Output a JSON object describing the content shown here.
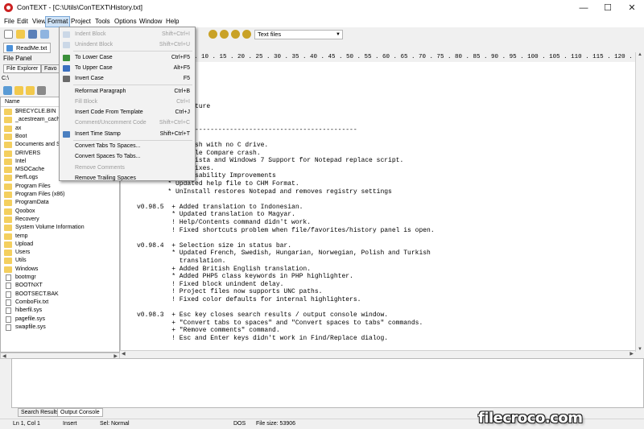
{
  "window": {
    "title": "ConTEXT - [C:\\Utils\\ConTEXT\\History.txt]",
    "minimize": "—",
    "maximize": "☐",
    "close": "✕"
  },
  "menubar": [
    "File",
    "Edit",
    "View",
    "Format",
    "Project",
    "Tools",
    "Options",
    "Window",
    "Help"
  ],
  "format_menu": {
    "items": [
      {
        "label": "Indent Block",
        "shortcut": "Shift+Ctrl+I",
        "enabled": false,
        "icon": "indent-icon"
      },
      {
        "label": "Unindent Block",
        "shortcut": "Shift+Ctrl+U",
        "enabled": false,
        "icon": "unindent-icon"
      },
      {
        "label": "To Lower Case",
        "shortcut": "Ctrl+F5",
        "enabled": true,
        "icon": "lowercase-icon"
      },
      {
        "label": "To Upper Case",
        "shortcut": "Alt+F5",
        "enabled": true,
        "icon": "uppercase-icon"
      },
      {
        "label": "Invert Case",
        "shortcut": "F5",
        "enabled": true,
        "icon": "invert-case-icon"
      },
      {
        "label": "Reformat Paragraph",
        "shortcut": "Ctrl+B",
        "enabled": true,
        "icon": ""
      },
      {
        "label": "Fill Block",
        "shortcut": "Ctrl+I",
        "enabled": false,
        "icon": ""
      },
      {
        "label": "Insert Code From Template",
        "shortcut": "Ctrl+J",
        "enabled": true,
        "icon": ""
      },
      {
        "label": "Comment/Uncomment Code",
        "shortcut": "Shift+Ctrl+C",
        "enabled": false,
        "icon": ""
      },
      {
        "label": "Insert Time Stamp",
        "shortcut": "Shift+Ctrl+T",
        "enabled": true,
        "icon": "timestamp-icon"
      },
      {
        "label": "Convert Tabs To Spaces...",
        "shortcut": "",
        "enabled": true,
        "icon": ""
      },
      {
        "label": "Convert Spaces To Tabs...",
        "shortcut": "",
        "enabled": true,
        "icon": ""
      },
      {
        "label": "Remove Comments",
        "shortcut": "",
        "enabled": false,
        "icon": ""
      },
      {
        "label": "Remove Trailing Spaces",
        "shortcut": "",
        "enabled": true,
        "icon": ""
      }
    ]
  },
  "toolbar": {
    "syntax_highlighter": "Text files"
  },
  "file_tab": "ReadMe.txt",
  "file_panel": {
    "title": "File Panel",
    "tabs": [
      "File Explorer",
      "Favo"
    ],
    "path": "C:\\",
    "column_header": "Name",
    "entries": [
      {
        "name": "$RECYCLE.BIN",
        "type": "folder"
      },
      {
        "name": "_acestream_cache",
        "type": "folder"
      },
      {
        "name": "ax",
        "type": "folder"
      },
      {
        "name": "Boot",
        "type": "folder"
      },
      {
        "name": "Documents and Se",
        "type": "folder"
      },
      {
        "name": "DRIVERS",
        "type": "folder"
      },
      {
        "name": "Intel",
        "type": "folder"
      },
      {
        "name": "MSOCache",
        "type": "folder"
      },
      {
        "name": "PerfLogs",
        "type": "folder"
      },
      {
        "name": "Program Files",
        "type": "folder"
      },
      {
        "name": "Program Files (x86)",
        "type": "folder"
      },
      {
        "name": "ProgramData",
        "type": "folder"
      },
      {
        "name": "Qoobox",
        "type": "folder"
      },
      {
        "name": "Recovery",
        "type": "folder"
      },
      {
        "name": "System Volume Information",
        "type": "folder"
      },
      {
        "name": "temp",
        "type": "folder"
      },
      {
        "name": "Upload",
        "type": "folder"
      },
      {
        "name": "Users",
        "type": "folder"
      },
      {
        "name": "Utils",
        "type": "folder"
      },
      {
        "name": "Windows",
        "type": "folder"
      },
      {
        "name": "bootmgr",
        "type": "file"
      },
      {
        "name": "BOOTNXT",
        "type": "file"
      },
      {
        "name": "BOOTSECT.BAK",
        "type": "file"
      },
      {
        "name": "ComboFix.txt",
        "type": "file"
      },
      {
        "name": "hiberfil.sys",
        "type": "file"
      },
      {
        "name": "pagefile.sys",
        "type": "file"
      },
      {
        "name": "swapfile.sys",
        "type": "file"
      }
    ]
  },
  "ruler": "2 . 10 . 15 . 20 . 25 . 30 . 35 . 40 . 45 . 50 . 55 . 60 . 65 . 70 . 75 . 80 . 85 . 90 . 95 . 100 . 105 . 110 . 115 . 120 . 125 . 130",
  "editor_lines": [
    "        NEW",
    "        ~~~",
    "",
    "",
    "          fix",
    "          d feature",
    "          ged",
    "",
    "    -----------------------------------------------------",
    "",
    "          s crash with no C drive.",
    "          ed File Compare crash.",
    "          ows Vista and Windows 7 Support for Notepad replace script.",
    "          Bug Fixes.",
    "        ! GUI Usability Improvements",
    "        * Updated help file to CHM Format.",
    "        * UnInstall restores Notepad and removes registry settings",
    "",
    "v0.98.5  + Added translation to Indonesian.",
    "         * Updated translation to Magyar.",
    "         ! Help/Contents command didn't work.",
    "         ! Fixed shortcuts problem when file/favorites/history panel is open.",
    "",
    "v0.98.4  + Selection size in status bar.",
    "         * Updated French, Swedish, Hungarian, Norwegian, Polish and Turkish",
    "           translation.",
    "         + Added British English translation.",
    "         * Added PHP5 class keywords in PHP highlighter.",
    "         ! Fixed block unindent delay.",
    "         ! Project files now supports UNC paths.",
    "         ! Fixed color defaults for internal highlighters.",
    "",
    "v0.98.3  + Esc key closes search results / output console window.",
    "         + \"Convert tabs to spaces\" and \"Convert spaces to tabs\" commands.",
    "         + \"Remove comments\" command.",
    "         ! Esc and Enter keys didn't work in Find/Replace dialog."
  ],
  "output_tabs": [
    "Search Results",
    "Output Console"
  ],
  "status": {
    "position": "Ln 1, Col 1",
    "mode": "Insert",
    "selection": "Sel: Normal",
    "format": "DOS",
    "file_size": "File size: 53906"
  },
  "watermark": "filecroco.com"
}
